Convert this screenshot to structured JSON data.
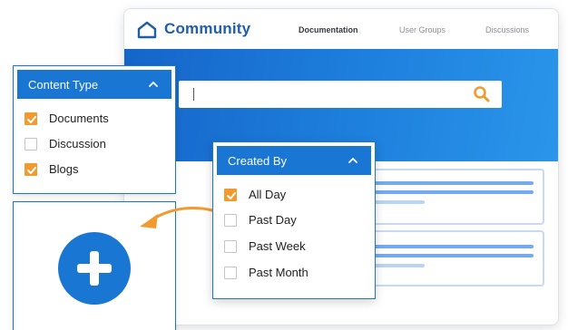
{
  "community_window": {
    "logo_text": "Community",
    "nav": [
      {
        "label": "Documentation",
        "active": true
      },
      {
        "label": "User Groups",
        "active": false
      },
      {
        "label": "Discussions",
        "active": false
      }
    ],
    "search_value": ""
  },
  "content_type_panel": {
    "title": "Content Type",
    "options": [
      {
        "label": "Documents",
        "checked": true
      },
      {
        "label": "Discussion",
        "checked": false
      },
      {
        "label": "Blogs",
        "checked": true
      }
    ]
  },
  "created_by_panel": {
    "title": "Created By",
    "options": [
      {
        "label": "All Day",
        "checked": true
      },
      {
        "label": "Past Day",
        "checked": false
      },
      {
        "label": "Past Week",
        "checked": false
      },
      {
        "label": "Past Month",
        "checked": false
      }
    ]
  },
  "colors": {
    "primary_blue": "#1976d2",
    "accent_orange": "#f29a2e",
    "logo_blue": "#1f5ea8"
  },
  "icons": {
    "logo": "house-outline-icon",
    "search": "search-icon",
    "collapse": "chevron-up-icon",
    "add": "plus-icon",
    "arrow": "curved-arrow-icon"
  }
}
